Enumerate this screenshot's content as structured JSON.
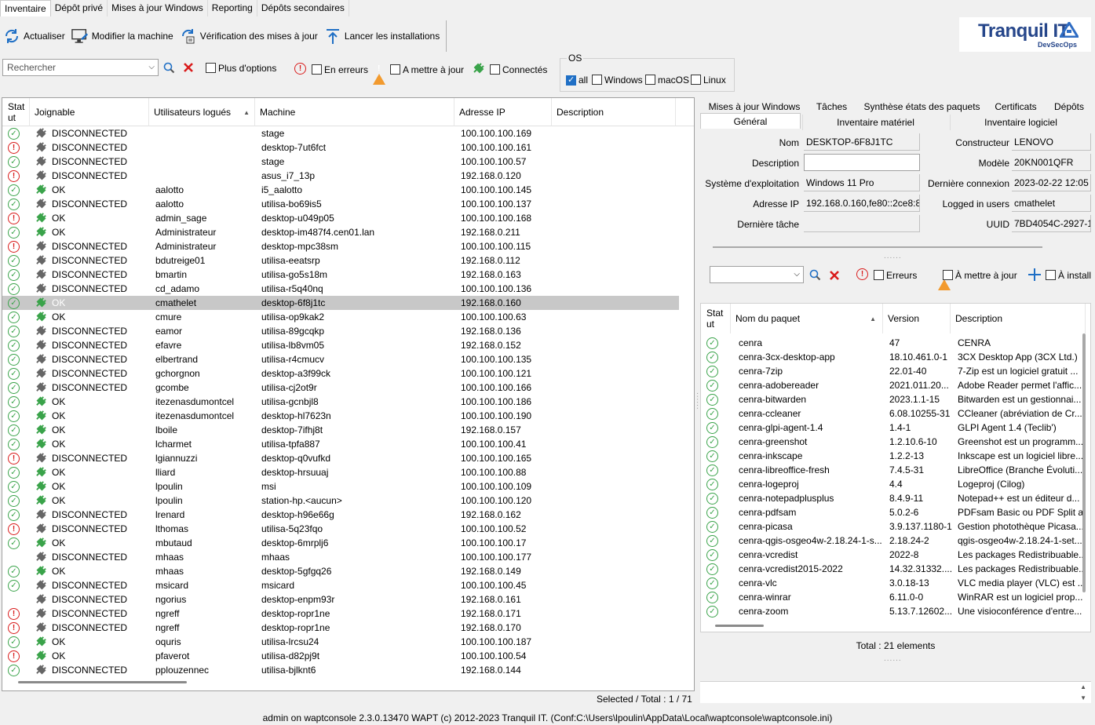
{
  "main_tabs": [
    "Inventaire",
    "Dépôt privé",
    "Mises à jour Windows",
    "Reporting",
    "Dépôts secondaires"
  ],
  "toolbar": {
    "refresh": "Actualiser",
    "edit_machine": "Modifier la machine",
    "check_updates": "Vérification des mises à jour",
    "launch_installs": "Lancer les installations"
  },
  "logo": {
    "main": "Tranquil IT",
    "sub": "DevSecOps"
  },
  "filters": {
    "search_placeholder": "Rechercher",
    "more_options": "Plus d'options",
    "in_errors": "En erreurs",
    "to_update": "A mettre à jour",
    "connected": "Connectés",
    "os_title": "OS",
    "os_all": "all",
    "os_windows": "Windows",
    "os_macos": "macOS",
    "os_linux": "Linux"
  },
  "colors": {
    "ok": "#3aa34a",
    "error": "#d91b1b",
    "warning": "#f29a2e",
    "accent": "#1f6fc5",
    "selected_row": "#c8c8c8"
  },
  "grid": {
    "headers": {
      "status": "Stat ut",
      "joignable": "Joignable",
      "users": "Utilisateurs logués",
      "machine": "Machine",
      "ip": "Adresse IP",
      "description": "Description"
    },
    "rows": [
      {
        "s": "ok",
        "c": false,
        "j": "DISCONNECTED",
        "u": "",
        "m": "stage",
        "ip": "100.100.100.169"
      },
      {
        "s": "err",
        "c": false,
        "j": "DISCONNECTED",
        "u": "",
        "m": "desktop-7ut6fct",
        "ip": "100.100.100.161"
      },
      {
        "s": "ok",
        "c": false,
        "j": "DISCONNECTED",
        "u": "",
        "m": "stage",
        "ip": "100.100.100.57"
      },
      {
        "s": "err",
        "c": false,
        "j": "DISCONNECTED",
        "u": "",
        "m": "asus_i7_13p",
        "ip": "192.168.0.120"
      },
      {
        "s": "ok",
        "c": true,
        "j": "OK",
        "u": "aalotto",
        "m": "i5_aalotto",
        "ip": "100.100.100.145"
      },
      {
        "s": "ok",
        "c": false,
        "j": "DISCONNECTED",
        "u": "aalotto",
        "m": "utilisa-bo69is5",
        "ip": "100.100.100.137"
      },
      {
        "s": "err",
        "c": true,
        "j": "OK",
        "u": "admin_sage",
        "m": "desktop-u049p05",
        "ip": "100.100.100.168"
      },
      {
        "s": "ok",
        "c": true,
        "j": "OK",
        "u": "Administrateur",
        "m": "desktop-im487f4.cen01.lan",
        "ip": "192.168.0.211"
      },
      {
        "s": "err",
        "c": false,
        "j": "DISCONNECTED",
        "u": "Administrateur",
        "m": "desktop-mpc38sm",
        "ip": "100.100.100.115"
      },
      {
        "s": "ok",
        "c": false,
        "j": "DISCONNECTED",
        "u": "bdutreige01",
        "m": "utilisa-eeatsrp",
        "ip": "192.168.0.112"
      },
      {
        "s": "ok",
        "c": false,
        "j": "DISCONNECTED",
        "u": "bmartin",
        "m": "utilisa-go5s18m",
        "ip": "192.168.0.163"
      },
      {
        "s": "ok",
        "c": false,
        "j": "DISCONNECTED",
        "u": "cd_adamo",
        "m": "utilisa-r5q40nq",
        "ip": "100.100.100.136"
      },
      {
        "s": "ok",
        "c": true,
        "j": "OK",
        "u": "cmathelet",
        "m": "desktop-6f8j1tc",
        "ip": "192.168.0.160",
        "sel": true
      },
      {
        "s": "ok",
        "c": true,
        "j": "OK",
        "u": "cmure",
        "m": "utilisa-op9kak2",
        "ip": "100.100.100.63"
      },
      {
        "s": "ok",
        "c": false,
        "j": "DISCONNECTED",
        "u": "eamor",
        "m": "utilisa-89gcqkp",
        "ip": "192.168.0.136"
      },
      {
        "s": "ok",
        "c": false,
        "j": "DISCONNECTED",
        "u": "efavre",
        "m": "utilisa-lb8vm05",
        "ip": "192.168.0.152"
      },
      {
        "s": "ok",
        "c": false,
        "j": "DISCONNECTED",
        "u": "elbertrand",
        "m": "utilisa-r4cmucv",
        "ip": "100.100.100.135"
      },
      {
        "s": "ok",
        "c": false,
        "j": "DISCONNECTED",
        "u": "gchorgnon",
        "m": "desktop-a3f99ck",
        "ip": "100.100.100.121"
      },
      {
        "s": "ok",
        "c": false,
        "j": "DISCONNECTED",
        "u": "gcombe",
        "m": "utilisa-cj2ot9r",
        "ip": "100.100.100.166"
      },
      {
        "s": "ok",
        "c": true,
        "j": "OK",
        "u": "itezenasdumontcel",
        "m": "utilisa-gcnbjl8",
        "ip": "100.100.100.186"
      },
      {
        "s": "ok",
        "c": true,
        "j": "OK",
        "u": "itezenasdumontcel",
        "m": "desktop-hl7623n",
        "ip": "100.100.100.190"
      },
      {
        "s": "ok",
        "c": true,
        "j": "OK",
        "u": "lboile",
        "m": "desktop-7ifhj8t",
        "ip": "192.168.0.157"
      },
      {
        "s": "ok",
        "c": true,
        "j": "OK",
        "u": "lcharmet",
        "m": "utilisa-tpfa887",
        "ip": "100.100.100.41"
      },
      {
        "s": "err",
        "c": false,
        "j": "DISCONNECTED",
        "u": "lgiannuzzi",
        "m": "desktop-q0vufkd",
        "ip": "100.100.100.165"
      },
      {
        "s": "ok",
        "c": true,
        "j": "OK",
        "u": "lliard",
        "m": "desktop-hrsuuaj",
        "ip": "100.100.100.88"
      },
      {
        "s": "ok",
        "c": true,
        "j": "OK",
        "u": "lpoulin",
        "m": "msi",
        "ip": "100.100.100.109"
      },
      {
        "s": "ok",
        "c": true,
        "j": "OK",
        "u": "lpoulin",
        "m": "station-hp.<aucun>",
        "ip": "100.100.100.120"
      },
      {
        "s": "ok",
        "c": false,
        "j": "DISCONNECTED",
        "u": "lrenard",
        "m": "desktop-h96e66g",
        "ip": "192.168.0.162"
      },
      {
        "s": "err",
        "c": false,
        "j": "DISCONNECTED",
        "u": "lthomas",
        "m": "utilisa-5q23fqo",
        "ip": "100.100.100.52"
      },
      {
        "s": "ok",
        "c": true,
        "j": "OK",
        "u": "mbutaud",
        "m": "desktop-6mrplj6",
        "ip": "100.100.100.17"
      },
      {
        "s": "warn",
        "c": false,
        "j": "DISCONNECTED",
        "u": "mhaas",
        "m": "mhaas",
        "ip": "100.100.100.177"
      },
      {
        "s": "ok",
        "c": true,
        "j": "OK",
        "u": "mhaas",
        "m": "desktop-5gfgq26",
        "ip": "192.168.0.149"
      },
      {
        "s": "ok",
        "c": false,
        "j": "DISCONNECTED",
        "u": "msicard",
        "m": "msicard",
        "ip": "100.100.100.45"
      },
      {
        "s": "warn",
        "c": false,
        "j": "DISCONNECTED",
        "u": "ngorius",
        "m": "desktop-enpm93r",
        "ip": "192.168.0.161"
      },
      {
        "s": "err",
        "c": false,
        "j": "DISCONNECTED",
        "u": "ngreff",
        "m": "desktop-ropr1ne",
        "ip": "192.168.0.171"
      },
      {
        "s": "err",
        "c": false,
        "j": "DISCONNECTED",
        "u": "ngreff",
        "m": "desktop-ropr1ne",
        "ip": "192.168.0.170"
      },
      {
        "s": "ok",
        "c": true,
        "j": "OK",
        "u": "oquris",
        "m": "utilisa-lrcsu24",
        "ip": "100.100.100.187"
      },
      {
        "s": "err",
        "c": true,
        "j": "OK",
        "u": "pfaverot",
        "m": "utilisa-d82pj9t",
        "ip": "100.100.100.54"
      },
      {
        "s": "ok",
        "c": false,
        "j": "DISCONNECTED",
        "u": "pplouzennec",
        "m": "utilisa-bjlknt6",
        "ip": "192.168.0.144"
      }
    ]
  },
  "selected_total": "Selected / Total : 1 / 71",
  "statusbar": "admin on waptconsole 2.3.0.13470 WAPT (c) 2012-2023 Tranquil IT. (Conf:C:\\Users\\lpoulin\\AppData\\Local\\waptconsole\\waptconsole.ini)",
  "right": {
    "tabs_top": [
      "Mises à jour Windows",
      "Tâches",
      "Synthèse états des paquets",
      "Certificats",
      "Dépôts"
    ],
    "tabs_bottom": [
      "Général",
      "Inventaire matériel",
      "Inventaire logiciel"
    ],
    "fields": {
      "name_label": "Nom",
      "name": "DESKTOP-6F8J1TC",
      "desc_label": "Description",
      "desc": "",
      "os_label": "Système d'exploitation",
      "os": "Windows 11 Pro",
      "ip_label": "Adresse IP",
      "ip": "192.168.0.160,fe80::2ce8:8e2",
      "last_task_label": "Dernière tâche",
      "last_task": "",
      "manufacturer_label": "Constructeur",
      "manufacturer": "LENOVO",
      "model_label": "Modèle",
      "model": "20KN001QFR",
      "last_conn_label": "Dernière connexion",
      "last_conn": "2023-02-22 12:05",
      "logged_label": "Logged in users",
      "logged": "cmathelet",
      "uuid_label": "UUID",
      "uuid": "7BD4054C-2927-11"
    },
    "pkg_filters": {
      "errors": "Erreurs",
      "to_update": "À mettre à jour",
      "to_install": "À install"
    },
    "pkg_headers": {
      "status": "Stat ut",
      "name": "Nom du paquet",
      "version": "Version",
      "description": "Description"
    },
    "packages": [
      {
        "n": "cenra",
        "v": "47",
        "d": "CENRA"
      },
      {
        "n": "cenra-3cx-desktop-app",
        "v": "18.10.461.0-1",
        "d": "3CX Desktop App (3CX Ltd.)"
      },
      {
        "n": "cenra-7zip",
        "v": "22.01-40",
        "d": "7-Zip est un logiciel gratuit ..."
      },
      {
        "n": "cenra-adobereader",
        "v": "2021.011.20...",
        "d": "Adobe Reader permet l'affic..."
      },
      {
        "n": "cenra-bitwarden",
        "v": "2023.1.1-15",
        "d": "Bitwarden est un gestionnai..."
      },
      {
        "n": "cenra-ccleaner",
        "v": "6.08.10255-31",
        "d": "CCleaner (abréviation de Cr..."
      },
      {
        "n": "cenra-glpi-agent-1.4",
        "v": "1.4-1",
        "d": "GLPI Agent 1.4 (Teclib')"
      },
      {
        "n": "cenra-greenshot",
        "v": "1.2.10.6-10",
        "d": "Greenshot est un programm..."
      },
      {
        "n": "cenra-inkscape",
        "v": "1.2.2-13",
        "d": "Inkscape est un logiciel libre..."
      },
      {
        "n": "cenra-libreoffice-fresh",
        "v": "7.4.5-31",
        "d": "LibreOffice (Branche Évoluti..."
      },
      {
        "n": "cenra-logeproj",
        "v": "4.4",
        "d": "Logeproj (Cilog)"
      },
      {
        "n": "cenra-notepadplusplus",
        "v": "8.4.9-11",
        "d": "Notepad++ est un éditeur d..."
      },
      {
        "n": "cenra-pdfsam",
        "v": "5.0.2-6",
        "d": "PDFsam Basic ou PDF Split a..."
      },
      {
        "n": "cenra-picasa",
        "v": "3.9.137.1180-1",
        "d": "Gestion photothèque Picasa..."
      },
      {
        "n": "cenra-qgis-osgeo4w-2.18.24-1-s...",
        "v": "2.18.24-2",
        "d": "qgis-osgeo4w-2.18.24-1-set..."
      },
      {
        "n": "cenra-vcredist",
        "v": "2022-8",
        "d": "Les packages Redistribuable..."
      },
      {
        "n": "cenra-vcredist2015-2022",
        "v": "14.32.31332....",
        "d": "Les packages Redistribuable..."
      },
      {
        "n": "cenra-vlc",
        "v": "3.0.18-13",
        "d": "VLC media player (VLC) est ..."
      },
      {
        "n": "cenra-winrar",
        "v": "6.11.0-0",
        "d": "WinRAR est un logiciel prop..."
      },
      {
        "n": "cenra-zoom",
        "v": "5.13.7.12602...",
        "d": "Une visioconférence d'entre..."
      }
    ],
    "pkg_total": "Total : 21 elements"
  }
}
